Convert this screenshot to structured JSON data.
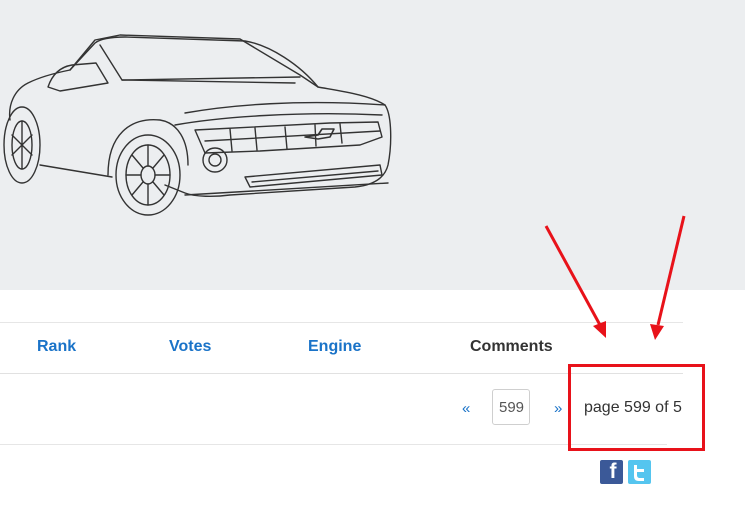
{
  "hero": {
    "image": "car-line-drawing"
  },
  "table_header": {
    "columns": [
      {
        "label": "Rank",
        "link": true
      },
      {
        "label": "Votes",
        "link": true
      },
      {
        "label": "Engine",
        "link": true
      },
      {
        "label": "Comments",
        "link": false
      }
    ]
  },
  "pagination": {
    "prev_label": "«",
    "next_label": "»",
    "page_input_value": "599",
    "page_text": "page 599 of 5"
  },
  "annotation": {
    "color": "#e8121a"
  },
  "social": {
    "facebook_glyph": "f",
    "facebook_color": "#3b5998",
    "twitter_color": "#55c5ef",
    "icons": [
      "facebook-icon",
      "twitter-icon"
    ]
  },
  "colors": {
    "hero_bg": "#eceef0",
    "link": "#1a73c8",
    "text": "#333333"
  }
}
